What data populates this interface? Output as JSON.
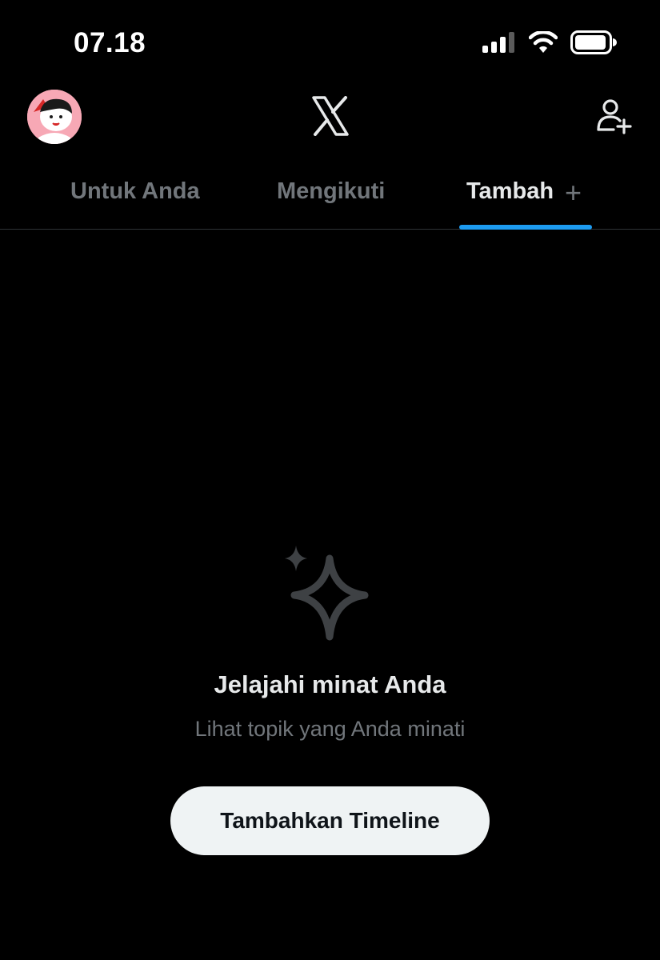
{
  "status_bar": {
    "time": "07.18",
    "icons": [
      "signal-icon",
      "wifi-icon",
      "battery-icon"
    ]
  },
  "header": {
    "avatar_icon": "avatar-cartoon",
    "logo_icon": "x-logo-icon",
    "follow_icon": "add-user-icon"
  },
  "tabs": [
    {
      "label": "Untuk Anda",
      "active": false
    },
    {
      "label": "Mengikuti",
      "active": false
    },
    {
      "label": "Tambah",
      "active": true,
      "suffix": "+"
    }
  ],
  "empty_state": {
    "icon": "sparkle-icon",
    "title": "Jelajahi minat Anda",
    "subtitle": "Lihat topik yang Anda minati",
    "button_label": "Tambahkan Timeline"
  },
  "colors": {
    "background": "#000000",
    "text_primary": "#e7e9ea",
    "text_secondary": "#71767b",
    "accent": "#1d9bf0",
    "button_bg": "#eff3f4",
    "divider": "#2f3336"
  }
}
